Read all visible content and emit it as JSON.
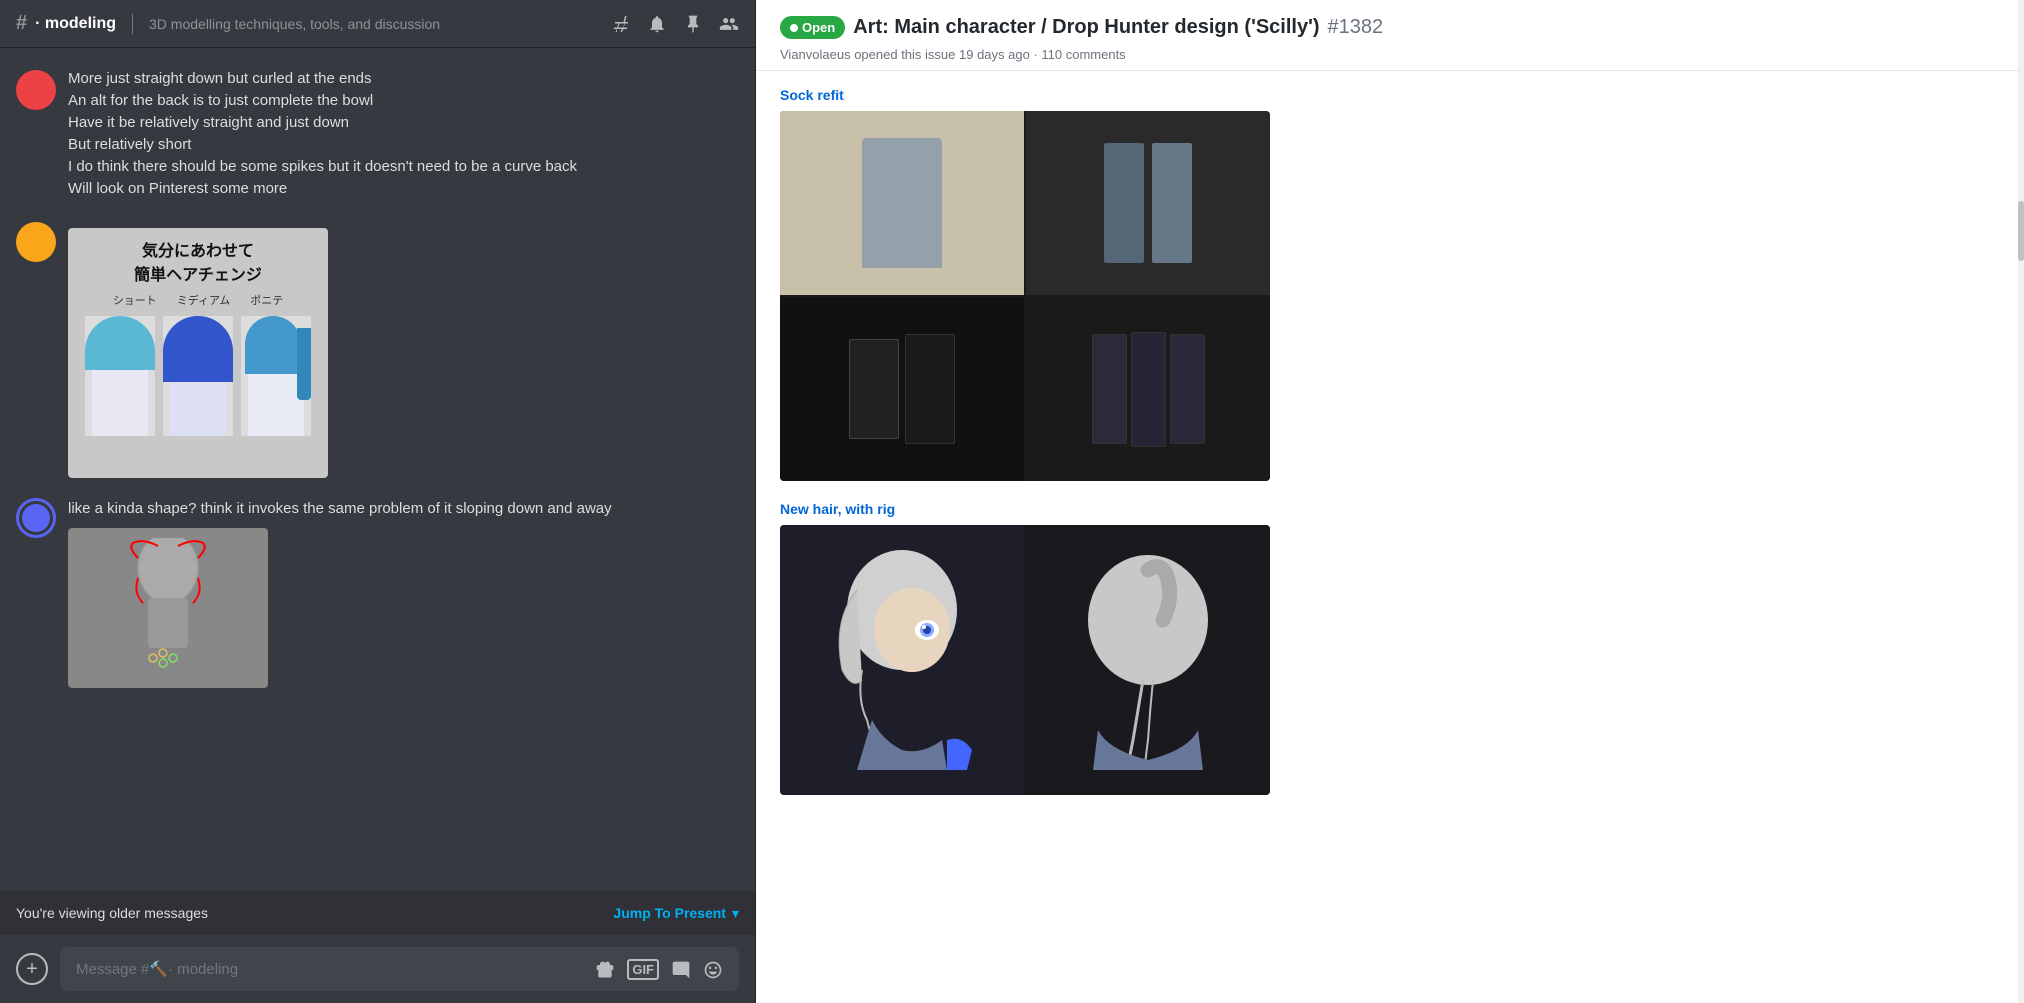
{
  "leftPanel": {
    "channel": {
      "icon": "#",
      "name": "· modeling",
      "topic": "3D modelling techniques, tools, and discussion"
    },
    "messages": [
      {
        "id": "msg1",
        "avatarType": "red",
        "lines": [
          "More just straight down but curled at the ends",
          "An alt for the back is to just complete the bowl",
          "Have it be relatively straight and just down",
          "But relatively short",
          "I do think there should be some spikes but it doesn't need to be a curve back",
          "Will look on Pinterest some more"
        ],
        "hasImage": true,
        "imageType": "hair"
      },
      {
        "id": "msg2",
        "avatarType": "blue-ring",
        "lines": [
          "like a kinda shape? think it invokes the same problem of it sloping down and away"
        ],
        "hasImage": true,
        "imageType": "sketch"
      }
    ],
    "olderBar": {
      "text": "You're viewing older messages",
      "jumpLabel": "Jump To Present"
    },
    "inputPlaceholder": "Message #🔨· modeling",
    "hairImageTitle": "気分にあわせて\n簡単ヘアチェンジ",
    "hairLabels": [
      "ショート",
      "ミディアム",
      "ポニテ"
    ]
  },
  "rightPanel": {
    "issueBadge": "Open",
    "issueTitle": "Art: Main character / Drop Hunter design ('Scilly')",
    "issueNumber": "#1382",
    "issueMeta": "Vianvolaeus opened this issue 19 days ago · 110 comments",
    "sections": [
      {
        "label": "Sock refit",
        "imageAlt": "Sock reference images"
      },
      {
        "label": "New hair, with rig",
        "imageAlt": "New hair with rig images"
      }
    ]
  }
}
